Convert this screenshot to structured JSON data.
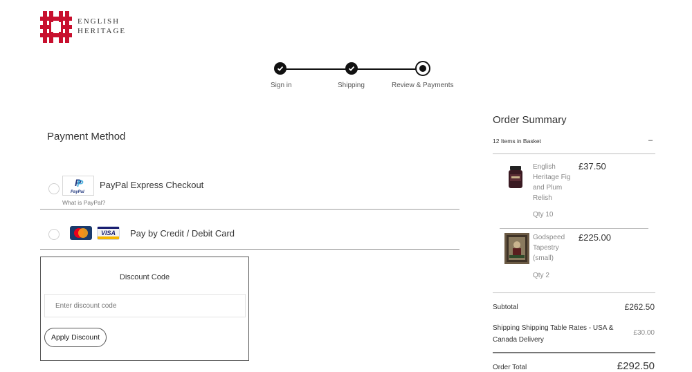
{
  "brand": {
    "line1": "ENGLISH",
    "line2": "HERITAGE",
    "color": "#c8102e"
  },
  "progress": {
    "steps": [
      {
        "label": "Sign in",
        "state": "complete"
      },
      {
        "label": "Shipping",
        "state": "complete"
      },
      {
        "label": "Review & Payments",
        "state": "current"
      }
    ]
  },
  "payment": {
    "title": "Payment Method",
    "options": [
      {
        "label": "PayPal Express Checkout",
        "logo_text": "PayPal",
        "help_link": "What is PayPal?"
      },
      {
        "label": "Pay by Credit / Debit Card",
        "visa_text": "VISA"
      }
    ]
  },
  "discount": {
    "title": "Discount Code",
    "placeholder": "Enter discount code",
    "button": "Apply Discount"
  },
  "summary": {
    "title": "Order Summary",
    "count": "12 Items in Basket",
    "toggle": "–",
    "items": [
      {
        "name": "English Heritage Fig and Plum Relish",
        "price": "£37.50",
        "qty": "Qty  10"
      },
      {
        "name": "Godspeed Tapestry (small)",
        "price": "£225.00",
        "qty": "Qty  2"
      }
    ],
    "subtotal_label": "Subtotal",
    "subtotal": "£262.50",
    "shipping_label": "Shipping Shipping Table Rates - USA & Canada Delivery",
    "shipping": "£30.00",
    "total_label": "Order Total",
    "total": "£292.50"
  }
}
